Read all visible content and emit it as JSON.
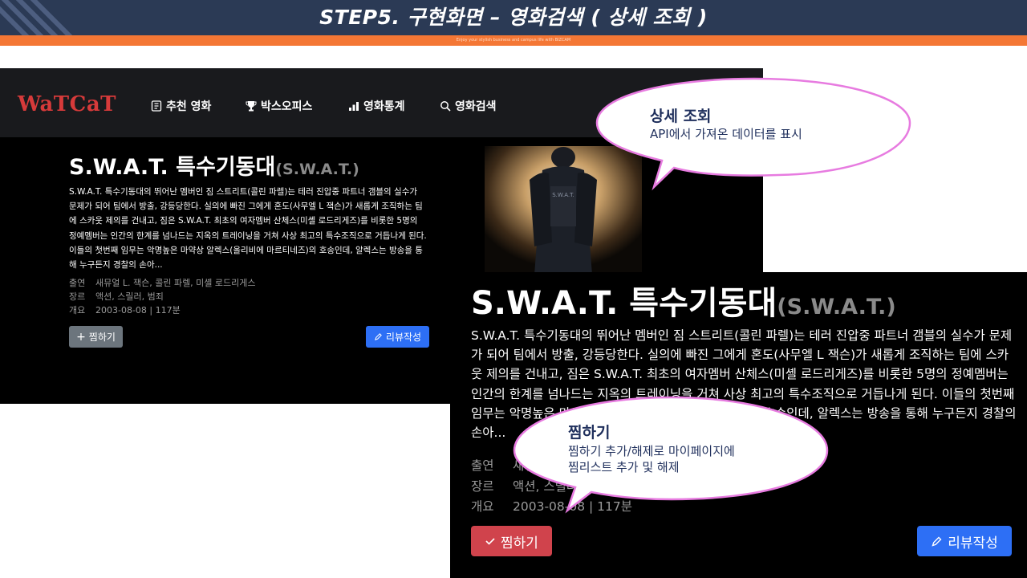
{
  "banner": {
    "title": "STEP5.  구현화면 – 영화검색 ( 상세 조회 )",
    "subtitle": "Enjoy your stylish business and campus life with BIZCAM"
  },
  "app": {
    "logo": "WaTCaT",
    "nav": [
      {
        "label": "추천 영화",
        "icon": "film-icon"
      },
      {
        "label": "박스오피스",
        "icon": "trophy-icon"
      },
      {
        "label": "영화통계",
        "icon": "bar-chart-icon"
      },
      {
        "label": "영화검색",
        "icon": "search-icon"
      }
    ]
  },
  "movie": {
    "title": "S.W.A.T. 특수기동대",
    "original_title": "(S.W.A.T.)",
    "overview_small": "S.W.A.T. 특수기동대의 뛰어난 멤버인 짐 스트리트(콜린 파렐)는 테러 진압중 파트너 갬블의 실수가 문제가 되어 팀에서 방출, 강등당한다. 실의에 빠진 그에게 혼도(사무엘 L 잭슨)가 새롭게 조직하는 팀에 스카웃 제의를 건내고, 짐은 S.W.A.T. 최초의 여자멤버 산체스(미셸 로드리게즈)를 비롯한 5명의 정예멤버는 인간의 한계를 넘나드는 지옥의 트레이닝을 거쳐 사상 최고의 특수조직으로 거듭나게 된다. 이들의 첫번째 임무는 악명높은 마약상 알렉스(올리비에 마르티네즈)의 호송인데, 알렉스는 방송을 통해 누구든지 경찰의 손아...",
    "overview_zoom": "S.W.A.T. 특수기동대의 뛰어난 멤버인 짐 스트리트(콜린 파렐)는 테러 진압중 파트너 갬블의 실수가 문제가 되어 팀에서 방출, 강등당한다. 실의에 빠진 그에게 혼도(사무엘 L 잭슨)가 새롭게 조직하는 팀에 스카웃 제의를 건내고, 짐은 S.W.A.T. 최초의 여자멤버 산체스(미셸 로드리게즈)를 비롯한 5명의 정예멤버는 인간의 한계를 넘나드는 지옥의 트레이닝을 거쳐 사상 최고의 특수조직으로 거듭나게 된다. 이들의 첫번째 임무는 악명높은 마약상 알렉스(올리비에 마르티네즈)의 호송인데, 알렉스는 방송을 통해 누구든지 경찰의 손아...",
    "cast_label": "출연",
    "cast": "새뮤얼 L. 잭슨, 콜린 파렐, 미셸 로드리게스",
    "genre_label": "장르",
    "genre": "액션, 스릴러, 범죄",
    "summary_label": "개요",
    "summary": "2003-08-08 | 117분",
    "wish_button_small": "찜하기",
    "wish_button_zoom": "찜하기",
    "review_button": "리뷰작성",
    "review_button_zoom": "리뷰작성"
  },
  "callouts": {
    "detail": {
      "title": "상세 조회",
      "text": "API에서 가져온 데이터를 표시"
    },
    "wish": {
      "title": "찜하기",
      "line1": "찜하기 추가/해제로 마이페이지에",
      "line2": "찜리스트 추가 및 해제"
    }
  },
  "colors": {
    "banner": "#2b3a55",
    "accent_orange": "#f47735",
    "logo_red": "#d63a3a",
    "wish_red": "#d0434c",
    "review_blue": "#2d6ff5",
    "wish_gray": "#6c757d",
    "callout_border": "#e77be0",
    "callout_text": "#1f2f5c"
  }
}
